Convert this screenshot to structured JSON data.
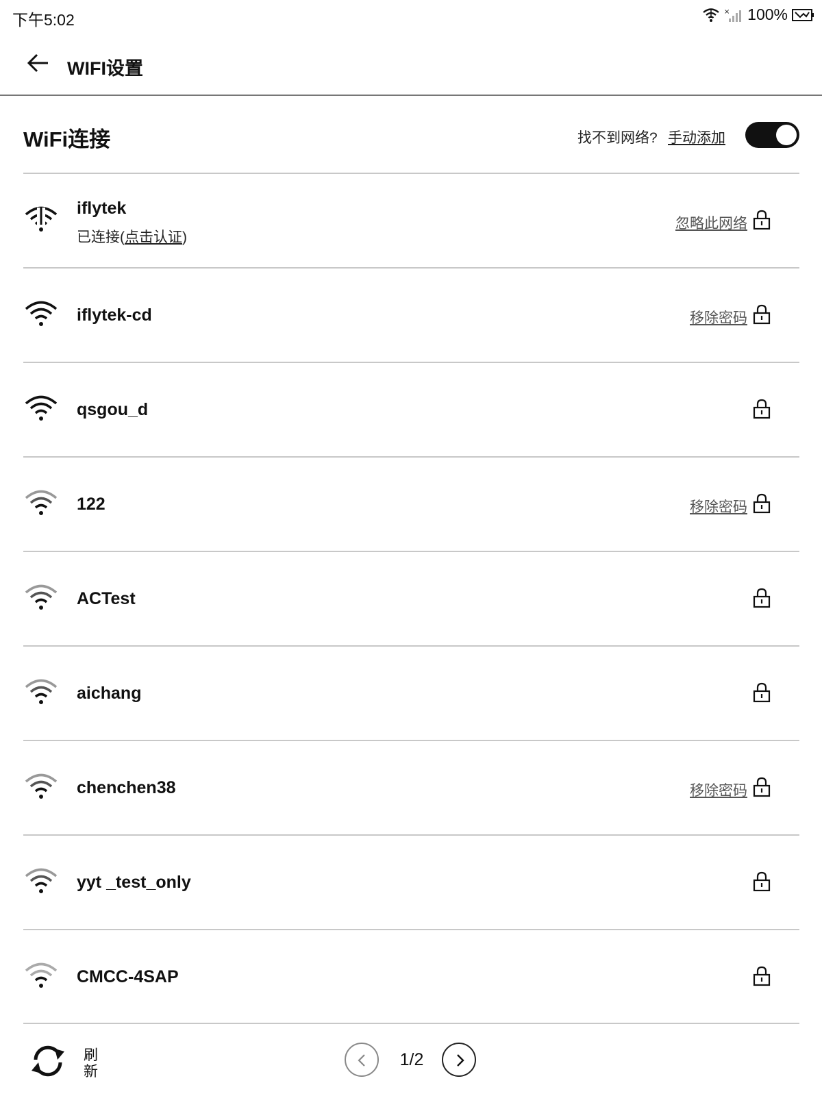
{
  "status_bar": {
    "time": "下午5:02",
    "battery": "100%",
    "icons": [
      "wifi-icon",
      "no-signal-icon",
      "battery-icon"
    ]
  },
  "app_bar": {
    "back_icon": "arrow-left-icon",
    "title": "WIFI设置"
  },
  "section": {
    "title": "WiFi连接",
    "cant_find_text": "找不到网络?",
    "manual_add_label": "手动添加",
    "wifi_enabled": true
  },
  "networks": [
    {
      "name": "iflytek",
      "status_prefix": "已连接(",
      "status_link": "点击认证",
      "status_suffix": ")",
      "action": "忽略此网络",
      "signal": "connected-auth",
      "locked": true
    },
    {
      "name": "iflytek-cd",
      "action": "移除密码",
      "signal": "strong",
      "locked": true
    },
    {
      "name": "qsgou_d",
      "action": "",
      "signal": "strong",
      "locked": true
    },
    {
      "name": "122",
      "action": "移除密码",
      "signal": "weak",
      "locked": true
    },
    {
      "name": "ACTest",
      "action": "",
      "signal": "weak",
      "locked": true
    },
    {
      "name": "aichang",
      "action": "",
      "signal": "weak",
      "locked": true
    },
    {
      "name": "chenchen38",
      "action": "移除密码",
      "signal": "weak",
      "locked": true
    },
    {
      "name": "yyt _test_only",
      "action": "",
      "signal": "weak",
      "locked": true
    },
    {
      "name": "CMCC-4SAP",
      "action": "",
      "signal": "weakest",
      "locked": true
    }
  ],
  "bottom_bar": {
    "refresh_label": "刷新",
    "page_indicator": "1/2",
    "prev_icon": "chevron-left-icon",
    "next_icon": "chevron-right-icon",
    "refresh_icon": "refresh-icon"
  },
  "colors": {
    "text": "#111111",
    "divider": "#c8c8c8",
    "toggle_on": "#111111",
    "action_text": "#555555"
  }
}
